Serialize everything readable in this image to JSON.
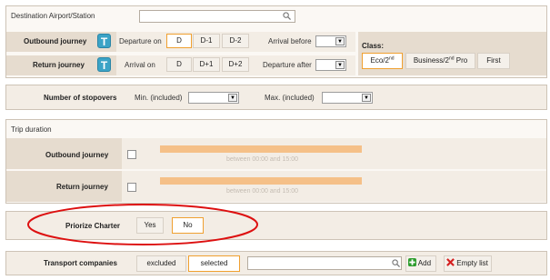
{
  "destination": {
    "label": "Destination Airport/Station",
    "value": ""
  },
  "outbound": {
    "label": "Outbound journey",
    "t_icon": "T",
    "departure_label": "Departure on",
    "options": [
      "D",
      "D-1",
      "D-2"
    ],
    "selected": "D",
    "arrival_label": "Arrival before",
    "arrival_value": ""
  },
  "return": {
    "label": "Return journey",
    "t_icon": "T",
    "arrival_label": "Arrival on",
    "options": [
      "D",
      "D+1",
      "D+2"
    ],
    "departure_label": "Departure after",
    "departure_value": ""
  },
  "class": {
    "label": "Class:",
    "options": [
      {
        "main": "Eco/2",
        "sup": "nd",
        "selected": true
      },
      {
        "main": "Business/2",
        "sup": "nd",
        "tail": " Pro",
        "selected": false
      },
      {
        "main": "First",
        "selected": false
      }
    ]
  },
  "stopovers": {
    "label": "Number of stopovers",
    "min_label": "Min. (included)",
    "min_value": "",
    "max_label": "Max. (included)",
    "max_value": ""
  },
  "trip_duration": {
    "title": "Trip duration",
    "outbound_label": "Outbound journey",
    "outbound_range": "between 00:00 and 15:00",
    "return_label": "Return journey",
    "return_range": "between 00:00 and 15:00"
  },
  "charter": {
    "label": "Priorize Charter",
    "yes": "Yes",
    "no": "No",
    "selected": "No",
    "highlight_color": "#dd1010"
  },
  "transport": {
    "label": "Transport companies",
    "excluded": "excluded",
    "selected_label": "selected",
    "active": "selected",
    "search_value": "",
    "add_label": "Add",
    "empty_label": "Empty list"
  },
  "colors": {
    "accent": "#f0a030",
    "band": "#e6dccf",
    "t_button": "#3ba3c6"
  }
}
